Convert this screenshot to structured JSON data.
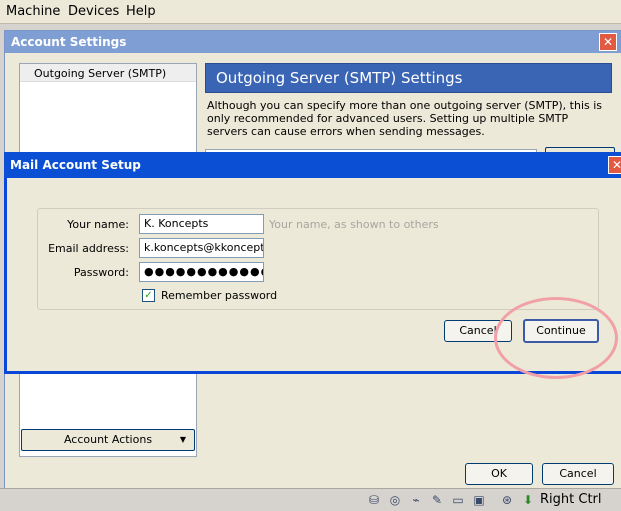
{
  "menubar": {
    "items": [
      {
        "label": "Machine"
      },
      {
        "label": "Devices"
      },
      {
        "label": "Help"
      }
    ]
  },
  "account_settings": {
    "title": "Account Settings",
    "sidebar_item": "Outgoing Server (SMTP)",
    "account_actions_label": "Account Actions",
    "header": "Outgoing Server (SMTP) Settings",
    "description": "Although you can specify more than one outgoing server (SMTP), this is only recommended for advanced users. Setting up multiple SMTP servers can cause errors when sending messages.",
    "ok_label": "OK",
    "cancel_label": "Cancel"
  },
  "mail_setup": {
    "title": "Mail Account Setup",
    "name_label": "Your name:",
    "name_value": "K. Koncepts",
    "name_hint": "Your name, as shown to others",
    "email_label": "Email address:",
    "email_value": "k.koncepts@kkoncepts.n",
    "password_label": "Password:",
    "password_value": "●●●●●●●●●●●●",
    "remember_label": "Remember password",
    "remember_checked": true,
    "cancel_label": "Cancel",
    "continue_label": "Continue",
    "highlight_color": "#f1a0a8"
  },
  "statusbar": {
    "icons": [
      "hard-disk-icon",
      "cd-icon",
      "usb-icon",
      "pencil-icon",
      "folder-icon",
      "display-icon",
      "network-icon",
      "mouse-integration-icon"
    ],
    "host_key": "Right Ctrl"
  }
}
